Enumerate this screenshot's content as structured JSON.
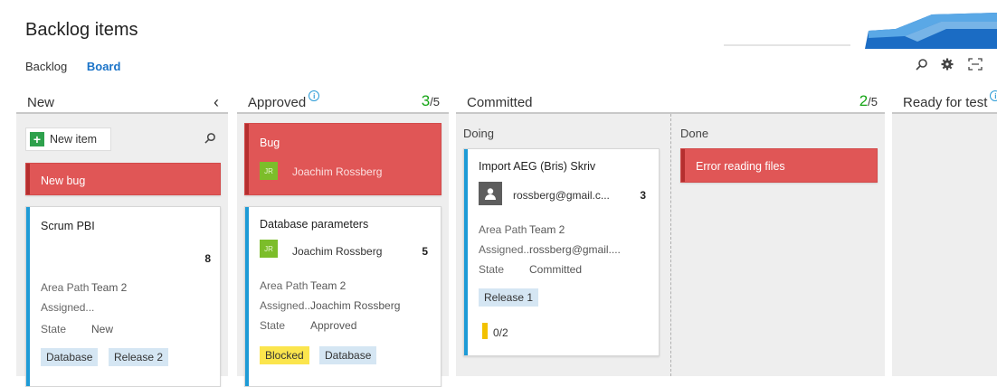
{
  "page": {
    "title": "Backlog items",
    "nav": [
      "Backlog",
      "Board"
    ],
    "toolbar_icons": [
      "search-icon",
      "gear-icon",
      "fullscreen-icon"
    ]
  },
  "columns": {
    "new": {
      "label": "New",
      "collapse": "‹"
    },
    "approved": {
      "label": "Approved",
      "info": "i",
      "wip_current": "3",
      "wip_limit": "/5"
    },
    "committed": {
      "label": "Committed",
      "wip_current": "2",
      "wip_limit": "/5"
    },
    "ready": {
      "label": "Ready for test",
      "info": "i"
    }
  },
  "sublanes": {
    "doing": "Doing",
    "done": "Done"
  },
  "new_item": {
    "plus": "+",
    "label": "New item"
  },
  "cards": {
    "new_bug": {
      "title": "New bug"
    },
    "scrum_pbi": {
      "title": "Scrum PBI",
      "effort": "8",
      "fields": [
        {
          "k": "Area Path",
          "v": "Team 2"
        },
        {
          "k": "Assigned...",
          "v": ""
        },
        {
          "k": "State",
          "v": "New"
        }
      ],
      "tags": [
        "Database",
        "Release 2"
      ]
    },
    "bug": {
      "title": "Bug",
      "avatar": "JR",
      "assignee": "Joachim Rossberg"
    },
    "database_parameters": {
      "title": "Database parameters",
      "avatar": "JR",
      "assignee": "Joachim Rossberg",
      "effort": "5",
      "fields": [
        {
          "k": "Area Path",
          "v": "Team 2"
        },
        {
          "k": "Assigned...",
          "v": "Joachim Rossberg"
        },
        {
          "k": "State",
          "v": "Approved"
        }
      ],
      "tags": [
        "Blocked",
        "Database"
      ]
    },
    "import_aeg": {
      "title": "Import AEG (Bris) Skriv",
      "assignee": "rossberg@gmail.c...",
      "effort": "3",
      "fields": [
        {
          "k": "Area Path",
          "v": "Team 2"
        },
        {
          "k": "Assigned...",
          "v": "rossberg@gmail...."
        },
        {
          "k": "State",
          "v": "Committed"
        }
      ],
      "tags": [
        "Release 1"
      ],
      "tasks": "0/2"
    },
    "error_reading": {
      "title": "Error reading files"
    }
  },
  "colors": {
    "accent": "#1a73c8",
    "red_card": "#e05656",
    "stripe_blue": "#1e9bd6",
    "wip_green": "#16a516",
    "tag_blue": "#d5e6f3",
    "tag_yellow": "#fbe54d"
  }
}
